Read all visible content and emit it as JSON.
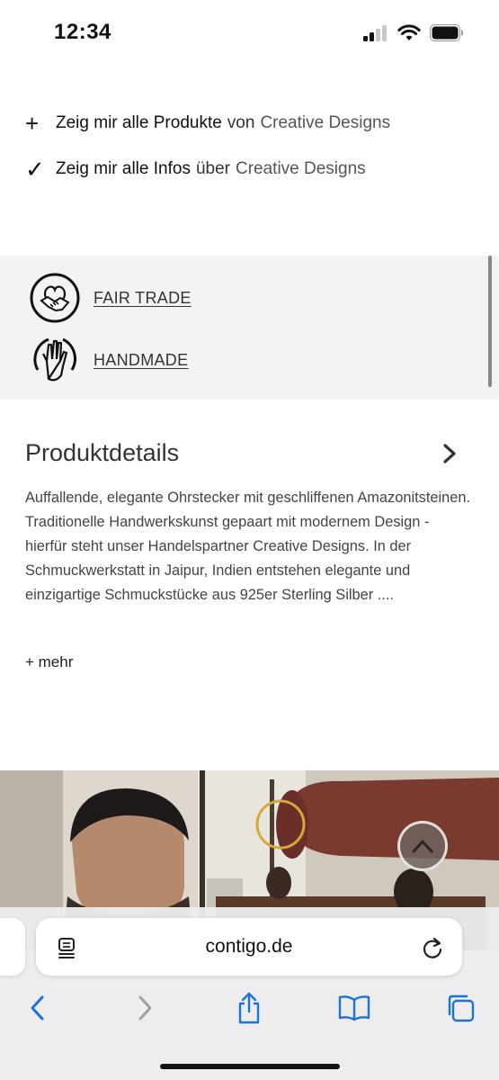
{
  "status_bar": {
    "time": "12:34"
  },
  "links": [
    {
      "symbol": "+",
      "strong": "Zeig mir alle Produkte",
      "mid": "von",
      "brand": "Creative Designs"
    },
    {
      "symbol": "✓",
      "strong": "Zeig mir alle Infos",
      "mid": "über",
      "brand": "Creative Designs"
    }
  ],
  "badges": [
    {
      "icon": "handshake-icon",
      "label": "FAIR TRADE"
    },
    {
      "icon": "hand-icon",
      "label": "HANDMADE"
    }
  ],
  "details": {
    "title": "Produktdetails",
    "body": "Auffallende, elegante Ohrstecker mit geschliffenen Amazonitsteinen. Traditionelle Handwerkskunst gepaart mit modernem Design - hierfür steht unser Handelspartner Creative Designs. In der Schmuckwerkstatt in Jaipur, Indien entstehen elegante und einzigartige Schmuckstücke aus 925er Sterling Silber ....",
    "more": "+ mehr"
  },
  "browser": {
    "url": "contigo.de",
    "toolbar": [
      "back-icon",
      "forward-icon",
      "share-icon",
      "bookmarks-icon",
      "tabs-overview-icon"
    ]
  },
  "colors": {
    "accent": "#1a73d9",
    "band": "#f4f3f1",
    "text": "#444444"
  }
}
